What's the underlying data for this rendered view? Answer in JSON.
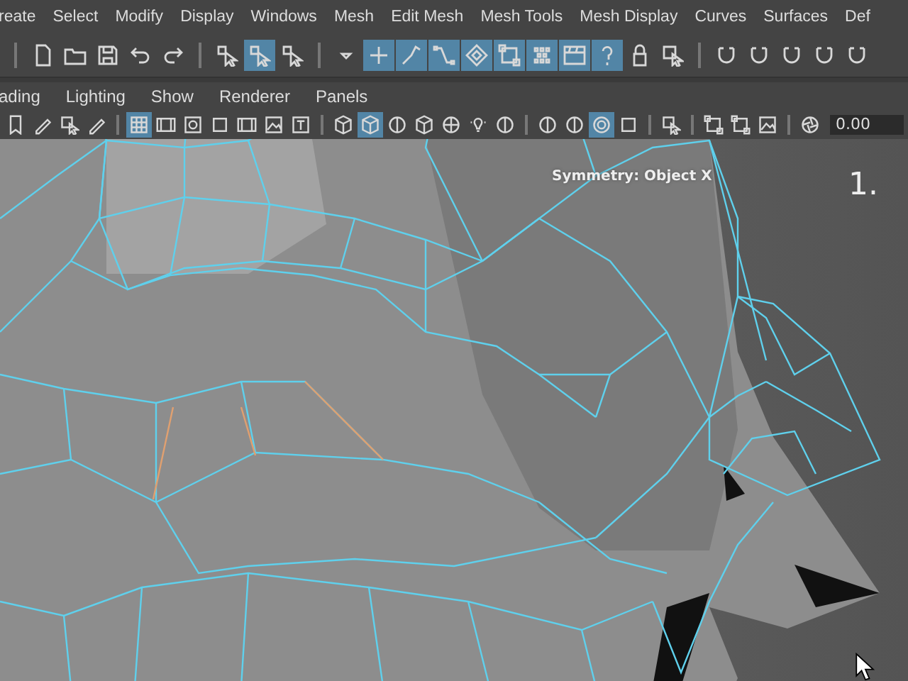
{
  "menu_bar": [
    "reate",
    "Select",
    "Modify",
    "Display",
    "Windows",
    "Mesh",
    "Edit Mesh",
    "Mesh Tools",
    "Mesh Display",
    "Curves",
    "Surfaces",
    "Def"
  ],
  "shelf": [
    {
      "kind": "separator"
    },
    {
      "kind": "file",
      "selected": false
    },
    {
      "kind": "folder",
      "selected": false
    },
    {
      "kind": "disk",
      "selected": false
    },
    {
      "kind": "undo",
      "selected": false
    },
    {
      "kind": "redo",
      "selected": false
    },
    {
      "kind": "separator"
    },
    {
      "kind": "cursor",
      "selected": false
    },
    {
      "kind": "cursor",
      "selected": true
    },
    {
      "kind": "cursor",
      "selected": false
    },
    {
      "kind": "separator"
    },
    {
      "kind": "caret",
      "selected": false
    },
    {
      "kind": "plus",
      "selected": true
    },
    {
      "kind": "bone",
      "selected": true
    },
    {
      "kind": "curve",
      "selected": true
    },
    {
      "kind": "diamond",
      "selected": true
    },
    {
      "kind": "square",
      "selected": true
    },
    {
      "kind": "dots",
      "selected": true
    },
    {
      "kind": "clapper",
      "selected": true
    },
    {
      "kind": "question",
      "selected": true
    },
    {
      "kind": "lock",
      "selected": false
    },
    {
      "kind": "marquee",
      "selected": false
    },
    {
      "kind": "separator"
    },
    {
      "kind": "magnet",
      "selected": false
    },
    {
      "kind": "magnet",
      "selected": false
    },
    {
      "kind": "magnet",
      "selected": false
    },
    {
      "kind": "magnet",
      "selected": false
    },
    {
      "kind": "magnet",
      "selected": false
    }
  ],
  "panel_menu": [
    "ading",
    "Lighting",
    "Show",
    "Renderer",
    "Panels"
  ],
  "panel_toolbar": [
    {
      "kind": "bookmark",
      "selected": false
    },
    {
      "kind": "pencil",
      "selected": false
    },
    {
      "kind": "marquee",
      "selected": false
    },
    {
      "kind": "pencil",
      "selected": false
    },
    {
      "kind": "separator"
    },
    {
      "kind": "grid",
      "selected": true
    },
    {
      "kind": "film",
      "selected": false
    },
    {
      "kind": "circle",
      "selected": false
    },
    {
      "kind": "dark",
      "selected": false
    },
    {
      "kind": "film",
      "selected": false
    },
    {
      "kind": "image",
      "selected": false
    },
    {
      "kind": "text",
      "selected": false
    },
    {
      "kind": "separator"
    },
    {
      "kind": "cube",
      "selected": false
    },
    {
      "kind": "cube",
      "selected": true
    },
    {
      "kind": "sphere",
      "selected": false
    },
    {
      "kind": "cube",
      "selected": false
    },
    {
      "kind": "checker",
      "selected": false
    },
    {
      "kind": "bulb",
      "selected": false
    },
    {
      "kind": "sphere",
      "selected": false
    },
    {
      "kind": "separator"
    },
    {
      "kind": "sphere",
      "selected": false
    },
    {
      "kind": "sphere",
      "selected": false
    },
    {
      "kind": "ring",
      "selected": true
    },
    {
      "kind": "dark",
      "selected": false
    },
    {
      "kind": "separator"
    },
    {
      "kind": "marquee",
      "selected": false
    },
    {
      "kind": "separator"
    },
    {
      "kind": "square",
      "selected": false
    },
    {
      "kind": "square",
      "selected": false
    },
    {
      "kind": "image",
      "selected": false
    },
    {
      "kind": "separator"
    },
    {
      "kind": "aperture",
      "selected": false
    }
  ],
  "exposure_field": {
    "value": "0.00"
  },
  "viewport": {
    "symmetry_label": "Symmetry: Object X",
    "camera_number": "1."
  }
}
